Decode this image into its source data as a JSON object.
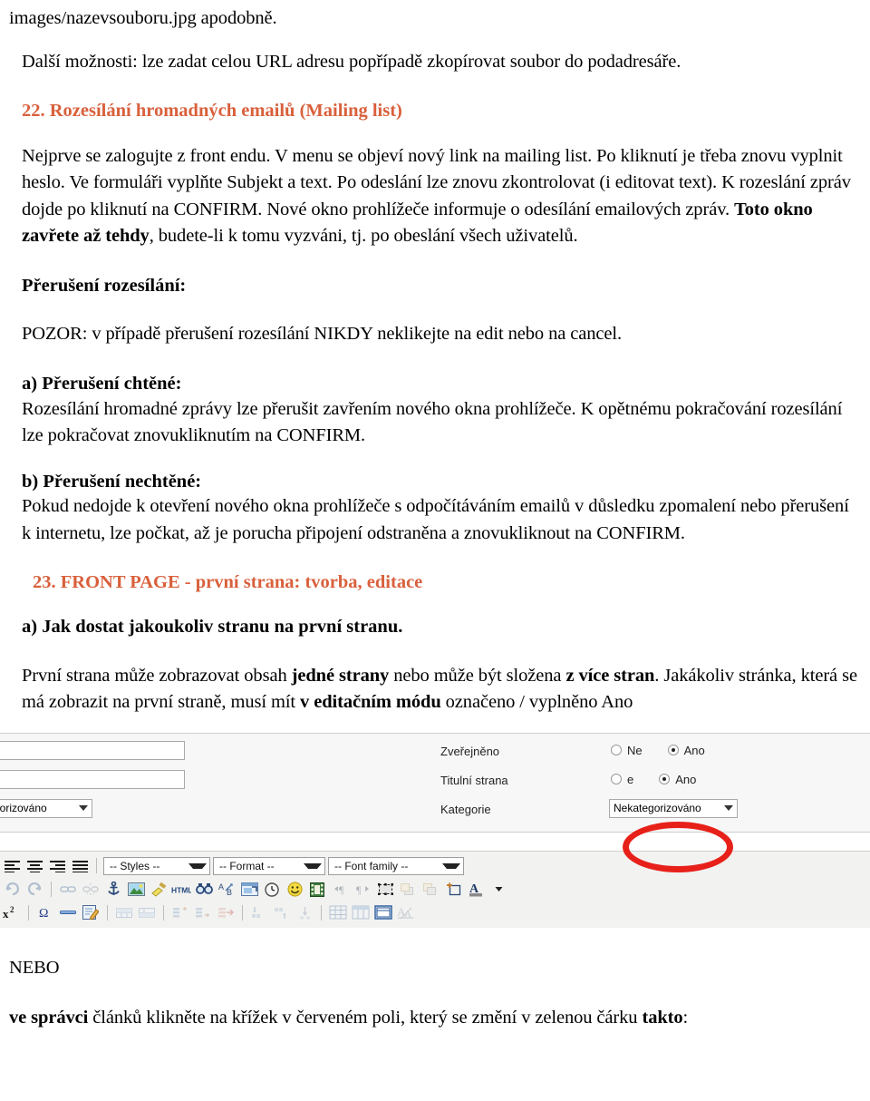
{
  "document": {
    "line_top": "images/nazevsouboru.jpg apodobně.",
    "para_further": "Další možnosti: lze zadat celou URL adresu popřípadě zkopírovat soubor do podadresáře.",
    "section_22_heading": "22. Rozesílání hromadných emailů (Mailing list)",
    "para_22": {
      "t1": "Nejprve se zalogujte z front endu. V menu se objeví nový link na mailing list. Po kliknutí  je třeba znovu vyplnit heslo. Ve formuláři vyplňte Subjekt a text. Po odeslání lze znovu zkontrolovat (i editovat text). K rozeslání zpráv dojde po kliknutí na CONFIRM. Nové okno prohlížeče informuje o odesílání emailových zpráv. ",
      "bold": "Toto okno zavřete až tehdy",
      "t2": ", budete-li k tomu vyzváni, tj. po obeslání všech uživatelů."
    },
    "interrupt_heading": "Přerušení rozesílání:",
    "interrupt_warning": "POZOR: v případě přerušení rozesílání NIKDY neklikejte na edit nebo na cancel.",
    "a_heading": "a) Přerušení chtěné:",
    "a_body": "Rozesílání hromadné zprávy lze přerušit zavřením nového okna prohlížeče. K opětnému pokračování rozesílání lze pokračovat znovukliknutím na CONFIRM.",
    "b_heading": "b) Přerušení nechtěné:",
    "b_body": "Pokud nedojde k otevření nového okna prohlížeče s odpočítáváním emailů v důsledku zpomalení nebo přerušení k internetu, lze počkat, až je porucha připojení odstraněna a znovukliknout na CONFIRM.",
    "section_23_heading": "23. FRONT PAGE - první strana: tvorba, editace",
    "a23_heading": "a) Jak dostat jakoukoliv stranu na první stranu.",
    "para_23": {
      "t1": "První strana může zobrazovat obsah ",
      "b1": "jedné strany",
      "t2": " nebo může být složena ",
      "b2": "z více stran",
      "t3": ". Jakákoliv stránka, která se má zobrazit na první straně, musí mít ",
      "b3": "v editačním módu",
      "t4": " označeno / vyplněno Ano"
    },
    "nebo": "NEBO",
    "final_para": {
      "b1": "ve správci",
      "t1": " článků klikněte na křížek v červeném poli, který se změní v zelenou čárku ",
      "b2": "takto",
      "t2": ":"
    }
  },
  "screenshot": {
    "form": {
      "labels": {
        "published": "Zveřejněno",
        "front_page": "Titulní strana",
        "category": "Kategorie"
      },
      "radio_no": "Ne",
      "radio_yes": "Ano",
      "radio_no_clipped": "e",
      "published_selected": "Ano",
      "front_page_selected": "Ano",
      "category_value_left": "gorizováno",
      "category_value_right": "Nekategorizováno",
      "input_1_value": "",
      "input_2_value": ""
    },
    "toolbar": {
      "styles_label": "-- Styles --",
      "format_label": "-- Format --",
      "font_family_label": "-- Font family --",
      "icons_row1": [
        "align-left-icon",
        "align-center-icon",
        "align-right-icon",
        "align-justify-icon"
      ],
      "icons_row2": [
        "undo-icon",
        "redo-icon",
        "link-icon",
        "unlink-icon",
        "anchor-icon",
        "insert-image-icon",
        "cleanup-icon",
        "html-source-icon",
        "search-icon",
        "replace-icon",
        "insert-date-icon",
        "insert-time-icon",
        "emoticon-icon",
        "insert-media-icon",
        "ltr-icon",
        "rtl-icon",
        "visual-aid-icon",
        "layer-forward-icon",
        "layer-backward-icon",
        "insert-layer-icon",
        "text-color-icon"
      ],
      "icons_row3": [
        "superscript-icon",
        "special-char-icon",
        "horizontal-rule-icon",
        "edit-icon",
        "insert-row-before-icon",
        "insert-row-after-icon",
        "insert-col-before-icon",
        "insert-col-after-icon",
        "delete-col-icon",
        "merge-cells-icon",
        "split-cells-icon",
        "delete-row-icon",
        "table-icon",
        "table-props-icon",
        "cell-props-icon",
        "remove-format-icon"
      ]
    },
    "annotation": {
      "shape": "red-ellipse-highlight",
      "color": "#e8201a"
    }
  },
  "colors": {
    "heading_orange": "#d9603c",
    "annotation_red": "#e8201a",
    "body_text": "#000000"
  }
}
